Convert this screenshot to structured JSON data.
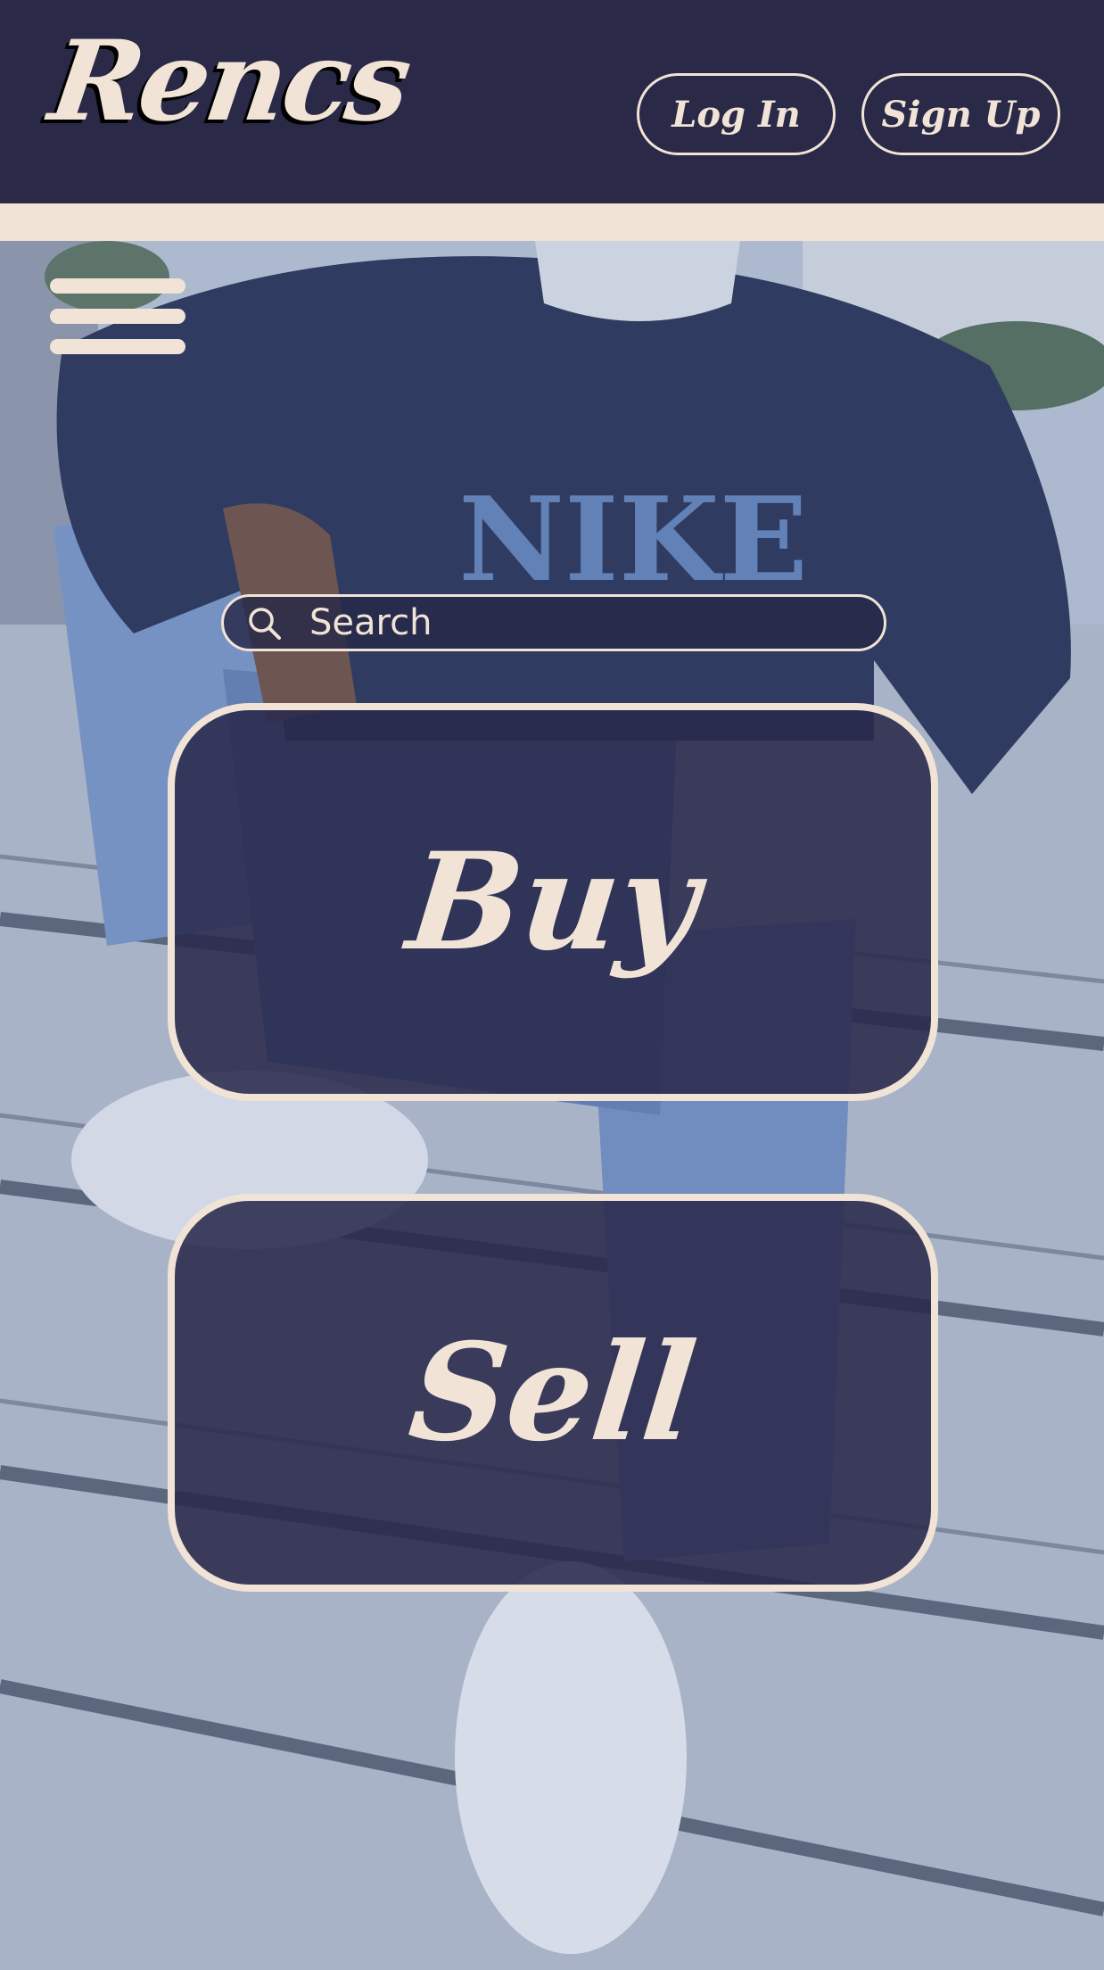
{
  "header": {
    "logo_text": "Rencs",
    "login_label": "Log In",
    "signup_label": "Sign Up"
  },
  "hero": {
    "background_image": "photo of a person in a navy NIKE sweatshirt, light jeans and white sneakers sitting on concrete steps",
    "shirt_text": "NIKE"
  },
  "menu": {
    "icon": "hamburger-menu-icon"
  },
  "search": {
    "placeholder": "Search",
    "icon": "search-icon"
  },
  "actions": {
    "buy_label": "Buy",
    "sell_label": "Sell"
  },
  "colors": {
    "navy": "#2a2a48",
    "cream": "#f1e4d6"
  }
}
